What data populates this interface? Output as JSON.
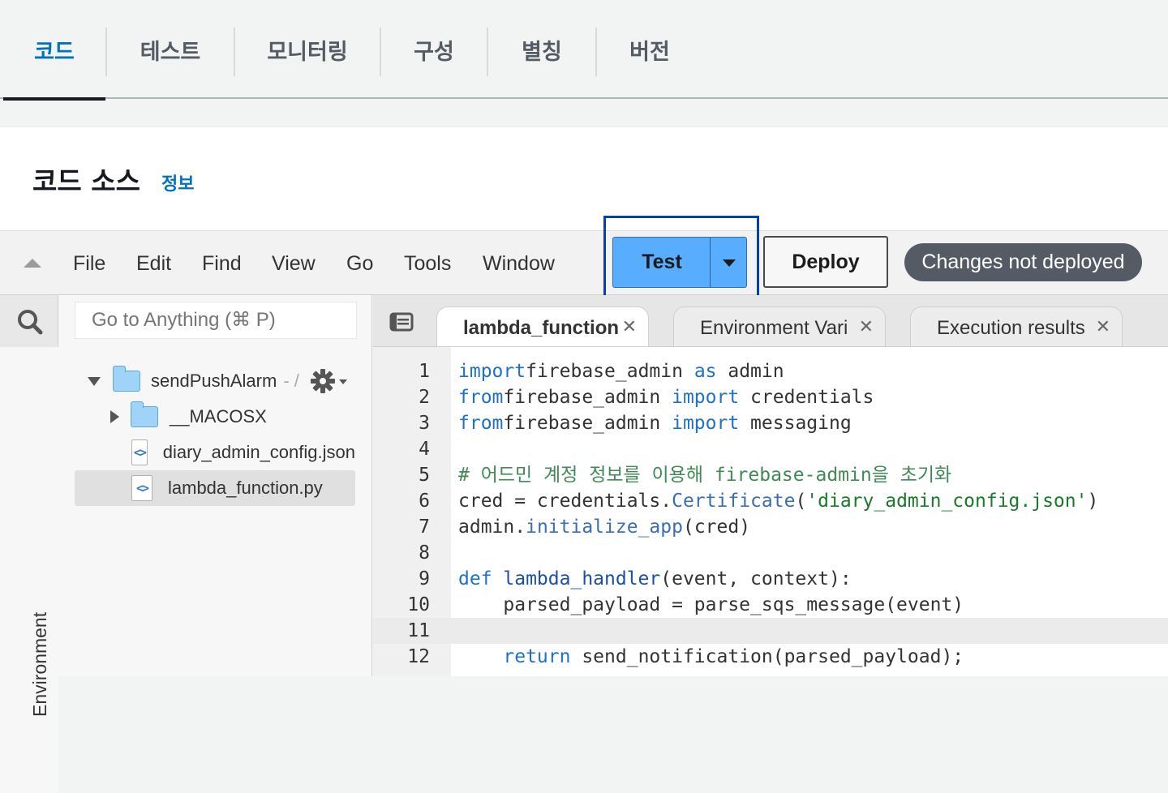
{
  "tabs": [
    "코드",
    "테스트",
    "모니터링",
    "구성",
    "별칭",
    "버전"
  ],
  "code_source": {
    "title": "코드 소스",
    "info_link": "정보"
  },
  "menu": [
    "File",
    "Edit",
    "Find",
    "View",
    "Go",
    "Tools",
    "Window"
  ],
  "actions": {
    "test_label": "Test",
    "deploy_label": "Deploy",
    "status_badge": "Changes not deployed"
  },
  "sidebar": {
    "search_placeholder": "Go to Anything (⌘ P)",
    "env_label": "Environment",
    "root_folder": "sendPushAlarm",
    "root_suffix": "- /",
    "items": [
      {
        "name": "__MACOSX",
        "type": "folder"
      },
      {
        "name": "diary_admin_config.json",
        "type": "file"
      },
      {
        "name": "lambda_function.py",
        "type": "file"
      }
    ]
  },
  "editor": {
    "tabs": [
      {
        "label": "lambda_function",
        "active": true
      },
      {
        "label": "Environment Vari",
        "active": false
      },
      {
        "label": "Execution results",
        "active": false
      }
    ],
    "lines": [
      {
        "no": "1",
        "tokens": [
          [
            "kw",
            "import"
          ],
          [
            "",
            "firebase_admin "
          ],
          [
            "kw",
            "as"
          ],
          [
            "",
            " admin"
          ]
        ]
      },
      {
        "no": "2",
        "tokens": [
          [
            "kw",
            "from"
          ],
          [
            "",
            "firebase_admin "
          ],
          [
            "kw",
            "import"
          ],
          [
            "",
            " credentials"
          ]
        ]
      },
      {
        "no": "3",
        "tokens": [
          [
            "kw",
            "from"
          ],
          [
            "",
            "firebase_admin "
          ],
          [
            "kw",
            "import"
          ],
          [
            "",
            " messaging"
          ]
        ]
      },
      {
        "no": "4",
        "tokens": []
      },
      {
        "no": "5",
        "tokens": [
          [
            "cm",
            "# 어드민 계정 정보를 이용해 firebase-admin을 초기화"
          ]
        ]
      },
      {
        "no": "6",
        "tokens": [
          [
            "",
            "cred = credentials."
          ],
          [
            "bi",
            "Certificate"
          ],
          [
            "",
            "("
          ],
          [
            "st",
            "'diary_admin_config.json'"
          ],
          [
            "",
            ")"
          ]
        ]
      },
      {
        "no": "7",
        "tokens": [
          [
            "",
            "admin."
          ],
          [
            "bi",
            "initialize_app"
          ],
          [
            "",
            "(cred)"
          ]
        ]
      },
      {
        "no": "8",
        "tokens": []
      },
      {
        "no": "9",
        "tokens": [
          [
            "kw",
            "def"
          ],
          [
            "fn",
            " lambda_handler"
          ],
          [
            "",
            "(event, context):"
          ]
        ]
      },
      {
        "no": "10",
        "tokens": [
          [
            "",
            "    parsed_payload = parse_sqs_message(event)"
          ]
        ]
      },
      {
        "no": "11",
        "tokens": []
      },
      {
        "no": "12",
        "tokens": [
          [
            "",
            "    "
          ],
          [
            "kw",
            "return"
          ],
          [
            "",
            " send_notification(parsed_payload);"
          ]
        ]
      }
    ]
  },
  "colors": {
    "accent": "#0073bb",
    "test_button": "#59adff",
    "badge": "#545b64"
  }
}
